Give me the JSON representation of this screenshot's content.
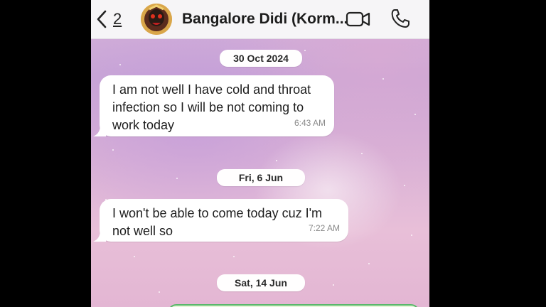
{
  "header": {
    "back_count": "2",
    "contact_name": "Bangalore Didi (Korm..."
  },
  "messages": [
    {
      "date": "30 Oct 2024",
      "lines": [
        "I am not well I have cold and throat",
        "infection so I will be not coming to",
        "work today"
      ],
      "time": "6:43 AM"
    },
    {
      "date": "Fri, 6 Jun",
      "lines": [
        "I won't be able to come today cuz I'm",
        "not well so"
      ],
      "time": "7:22 AM"
    }
  ],
  "date3": "Sat, 14 Jun",
  "icons": [
    "back-chevron-icon",
    "avatar",
    "video-call-icon",
    "voice-call-icon"
  ],
  "colors": {
    "header_bg": "#f6f5f7",
    "bubble_bg": "#ffffff",
    "wallpaper": "#d9b4d8",
    "outgoing_border": "#58b86a"
  }
}
